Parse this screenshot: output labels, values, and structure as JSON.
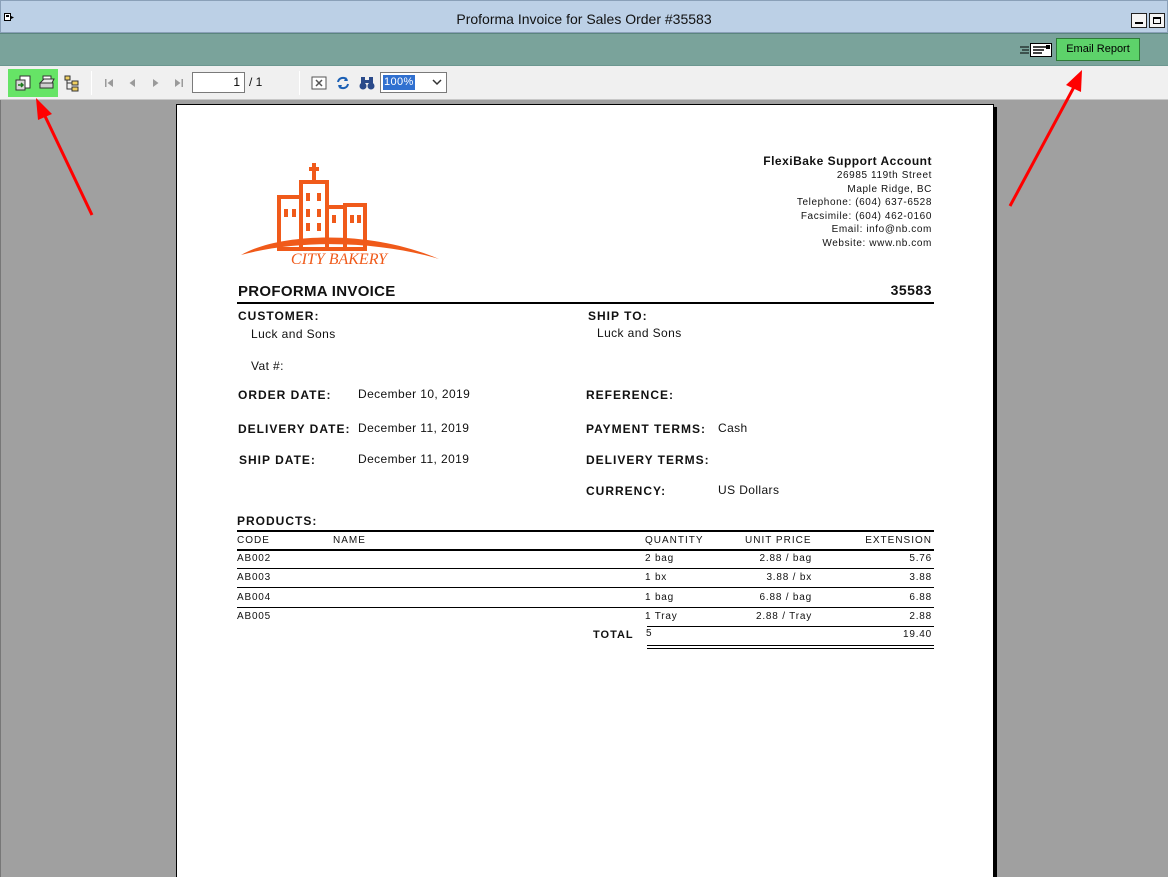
{
  "window": {
    "title": "Proforma Invoice for Sales Order #35583"
  },
  "tealbar": {
    "email_button_label": "Email Report",
    "email_icon": "email-envelope-icon"
  },
  "toolbar": {
    "current_page": "1",
    "page_total": "/ 1",
    "zoom": "100%",
    "icons": [
      "export-icon",
      "print-icon",
      "group-tree-icon",
      "first-page-icon",
      "previous-page-icon",
      "next-page-icon",
      "last-page-icon",
      "close-view-icon",
      "refresh-icon",
      "search-binoculars-icon"
    ],
    "highlight_color": "#66e466"
  },
  "invoice": {
    "company": {
      "name": "FlexiBake Support Account",
      "street": "26985 119th Street",
      "city": "Maple Ridge, BC",
      "telephone": "Telephone: (604) 637-6528",
      "facsimile": "Facsimile: (604) 462-0160",
      "email": "Email: info@nb.com",
      "website": "Website: www.nb.com"
    },
    "logo_text": "CITY BAKERY",
    "logo_color": "#f05a1a",
    "title": "PROFORMA INVOICE",
    "number": "35583",
    "customer_label": "CUSTOMER:",
    "customer_name": "Luck and Sons",
    "vat_label": "Vat #:",
    "ship_to_label": "SHIP TO:",
    "ship_to_name": "Luck and Sons",
    "order_date_label": "ORDER DATE:",
    "order_date": "December 10, 2019",
    "delivery_date_label": "DELIVERY DATE:",
    "delivery_date": "December 11, 2019",
    "ship_date_label": "SHIP DATE:",
    "ship_date": "December 11, 2019",
    "reference_label": "REFERENCE:",
    "payment_terms_label": "PAYMENT TERMS:",
    "payment_terms": "Cash",
    "delivery_terms_label": "DELIVERY TERMS:",
    "currency_label": "CURRENCY:",
    "currency": "US Dollars",
    "products_label": "PRODUCTS:",
    "columns": {
      "code": "CODE",
      "name": "NAME",
      "quantity": "QUANTITY",
      "unit_price": "UNIT PRICE",
      "extension": "EXTENSION"
    },
    "rows": [
      {
        "code": "AB002",
        "name": "",
        "quantity": "2 bag",
        "unit_price": "2.88 / bag",
        "extension": "5.76"
      },
      {
        "code": "AB003",
        "name": "",
        "quantity": "1 bx",
        "unit_price": "3.88 / bx",
        "extension": "3.88"
      },
      {
        "code": "AB004",
        "name": "",
        "quantity": "1 bag",
        "unit_price": "6.88 / bag",
        "extension": "6.88"
      },
      {
        "code": "AB005",
        "name": "",
        "quantity": "1 Tray",
        "unit_price": "2.88 / Tray",
        "extension": "2.88"
      }
    ],
    "total_label": "TOTAL",
    "total_quantity": "5",
    "total_extension": "19.40"
  },
  "annotation_color": "#ff0000"
}
